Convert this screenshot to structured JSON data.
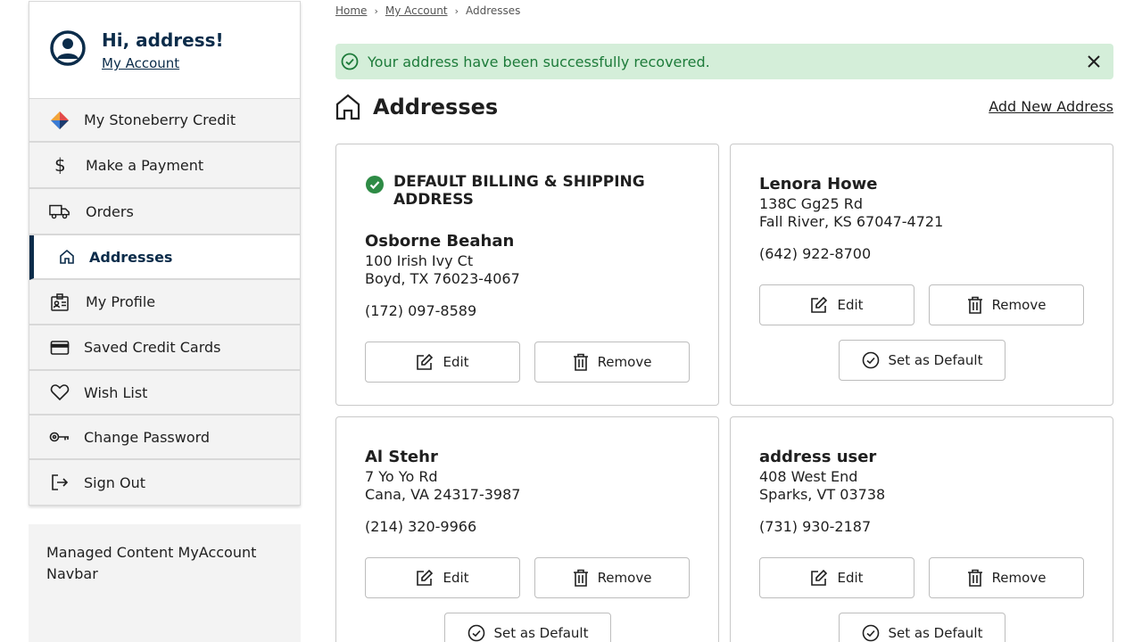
{
  "greeting": {
    "hi": "Hi, address!",
    "my_account": "My Account"
  },
  "sidebar": {
    "items": [
      {
        "label": "My Stoneberry Credit",
        "icon": "stoneberry-credit-icon"
      },
      {
        "label": "Make a Payment",
        "icon": "dollar-icon"
      },
      {
        "label": "Orders",
        "icon": "truck-icon"
      },
      {
        "label": "Addresses",
        "icon": "house-icon",
        "active": true
      },
      {
        "label": "My Profile",
        "icon": "profile-badge-icon"
      },
      {
        "label": "Saved Credit Cards",
        "icon": "credit-card-icon"
      },
      {
        "label": "Wish List",
        "icon": "heart-icon"
      },
      {
        "label": "Change Password",
        "icon": "key-icon"
      },
      {
        "label": "Sign Out",
        "icon": "sign-out-icon"
      }
    ]
  },
  "managed_content": "Managed Content MyAccount Navbar",
  "breadcrumb": {
    "home": "Home",
    "my_account": "My Account",
    "current": "Addresses"
  },
  "alert": {
    "message": "Your address have been successfully recovered.",
    "color": "#1d7b3a",
    "bg": "#d4eed9"
  },
  "page": {
    "title": "Addresses",
    "add_new": "Add New Address"
  },
  "buttons": {
    "edit": "Edit",
    "remove": "Remove",
    "set_default": "Set as Default"
  },
  "addresses": [
    {
      "badge": "DEFAULT BILLING & SHIPPING ADDRESS",
      "name": "Osborne Beahan",
      "street": "100 Irish Ivy Ct",
      "city": "Boyd, TX 76023-4067",
      "phone": "(172) 097-8589"
    },
    {
      "name": "Lenora Howe",
      "street": "138C Gg25 Rd",
      "city": "Fall River, KS 67047-4721",
      "phone": "(642) 922-8700"
    },
    {
      "name": "Al Stehr",
      "street": "7 Yo Yo Rd",
      "city": "Cana, VA 24317-3987",
      "phone": "(214) 320-9966"
    },
    {
      "name": "address user",
      "street": "408 West End",
      "city": "Sparks, VT 03738",
      "phone": "(731) 930-2187"
    }
  ],
  "colors": {
    "navy": "#0b2c4a",
    "success_green": "#2e8b45"
  }
}
